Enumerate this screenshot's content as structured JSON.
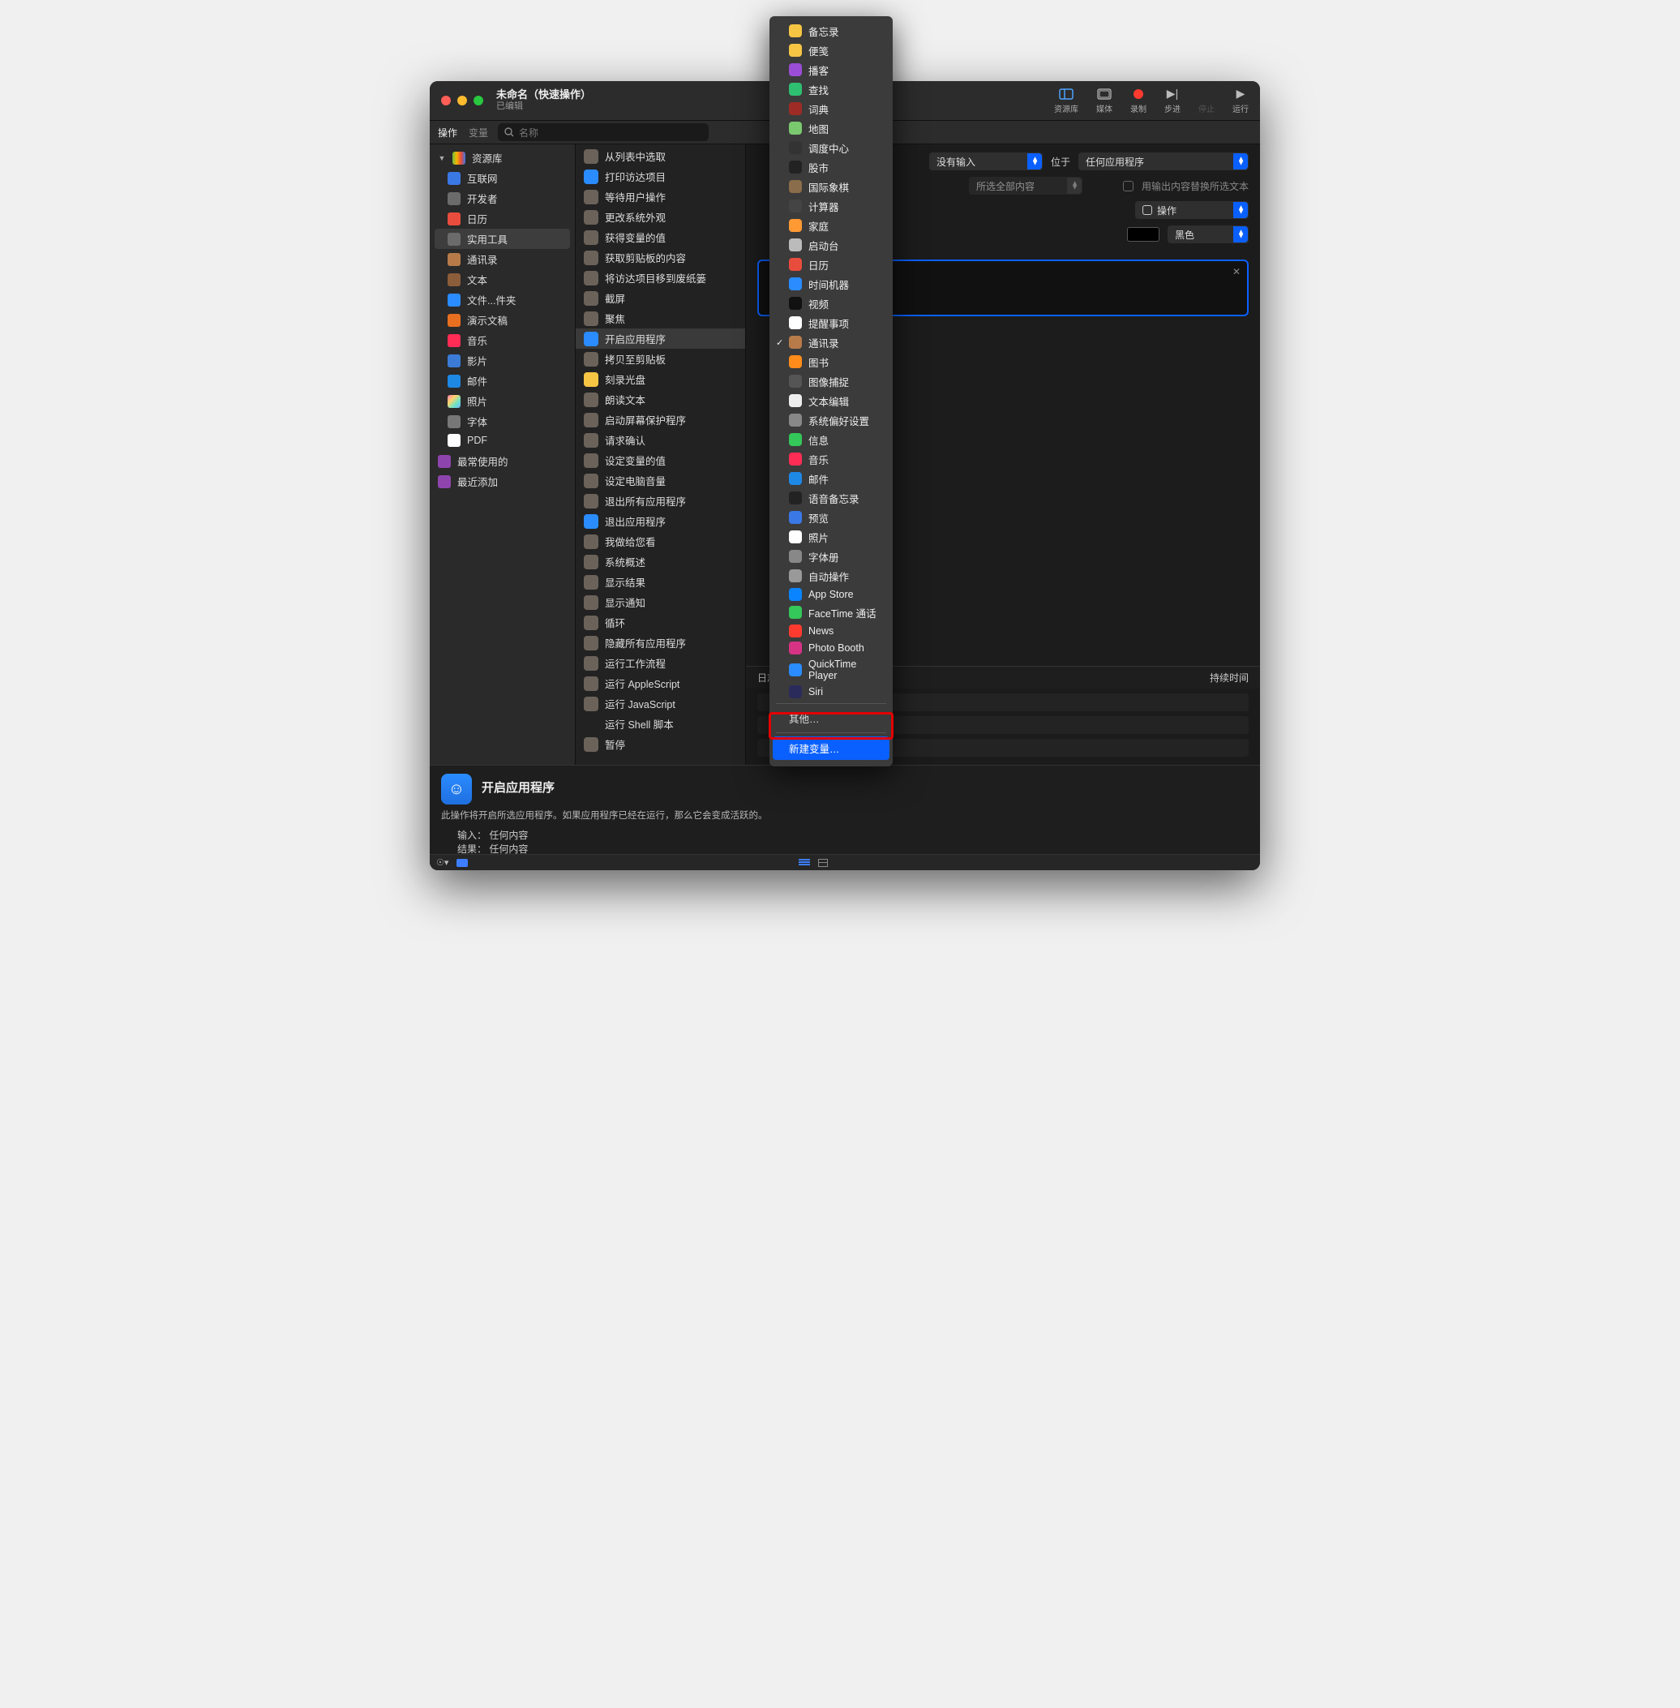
{
  "window": {
    "title": "未命名（快速操作）",
    "subtitle": "已编辑"
  },
  "toolbar": {
    "library": "资源库",
    "media": "媒体",
    "record": "录制",
    "step": "步进",
    "stop": "停止",
    "run": "运行"
  },
  "secondbar": {
    "tab_actions": "操作",
    "tab_vars": "变量",
    "search_placeholder": "名称"
  },
  "sidebar": {
    "root": "资源库",
    "items": [
      {
        "label": "互联网",
        "color": "#3a78e6"
      },
      {
        "label": "开发者",
        "color": "#6b6b6b"
      },
      {
        "label": "日历",
        "color": "#e84c3d"
      },
      {
        "label": "实用工具",
        "color": "#6b6b6b",
        "selected": true
      },
      {
        "label": "通讯录",
        "color": "#b77b4a"
      },
      {
        "label": "文本",
        "color": "#8b5d3a"
      },
      {
        "label": "文件...件夹",
        "color": "#2a8cff"
      },
      {
        "label": "演示文稿",
        "color": "#e86f1f"
      },
      {
        "label": "音乐",
        "color": "#ff2d55"
      },
      {
        "label": "影片",
        "color": "#3b7bd6"
      },
      {
        "label": "邮件",
        "color": "#1e88e5"
      },
      {
        "label": "照片",
        "color": "linear"
      },
      {
        "label": "字体",
        "color": "#777"
      },
      {
        "label": "PDF",
        "color": "#fff"
      }
    ],
    "footer": [
      {
        "label": "最常使用的"
      },
      {
        "label": "最近添加"
      }
    ]
  },
  "actions": [
    "从列表中选取",
    "打印访达项目",
    "等待用户操作",
    "更改系统外观",
    "获得变量的值",
    "获取剪贴板的内容",
    "将访达项目移到废纸篓",
    "截屏",
    "聚焦",
    "开启应用程序",
    "拷贝至剪贴板",
    "刻录光盘",
    "朗读文本",
    "启动屏幕保护程序",
    "请求确认",
    "设定变量的值",
    "设定电脑音量",
    "退出所有应用程序",
    "退出应用程序",
    "我做给您看",
    "系统概述",
    "显示结果",
    "显示通知",
    "循环",
    "隐藏所有应用程序",
    "运行工作流程",
    "运行 AppleScript",
    "运行 JavaScript",
    "运行 Shell 脚本",
    "暂停"
  ],
  "actions_selected_index": 9,
  "config": {
    "no_input": "没有输入",
    "at": "位于",
    "any_app": "任何应用程序",
    "all_selected": "所选全部内容",
    "replace_chk_label": "用输出内容替换所选文本",
    "action_label": "操作",
    "black": "黑色"
  },
  "log": {
    "title": "日志",
    "duration": "持续时间"
  },
  "desc": {
    "title": "开启应用程序",
    "body": "此操作将开启所选应用程序。如果应用程序已经在运行，那么它会变成活跃的。",
    "input_k": "输入：",
    "input_v": "任何内容",
    "result_k": "结果：",
    "result_v": "任何内容"
  },
  "dropdown": {
    "apps": [
      {
        "label": "备忘录",
        "c": "#f7c544"
      },
      {
        "label": "便笺",
        "c": "#f7c544"
      },
      {
        "label": "播客",
        "c": "#9b4dd6"
      },
      {
        "label": "查找",
        "c": "#2fbf71"
      },
      {
        "label": "词典",
        "c": "#9e2b25"
      },
      {
        "label": "地图",
        "c": "#7bc96f"
      },
      {
        "label": "调度中心",
        "c": "#333"
      },
      {
        "label": "股市",
        "c": "#222"
      },
      {
        "label": "国际象棋",
        "c": "#8a6d4a"
      },
      {
        "label": "计算器",
        "c": "#444"
      },
      {
        "label": "家庭",
        "c": "#ff9933"
      },
      {
        "label": "启动台",
        "c": "#bbb"
      },
      {
        "label": "日历",
        "c": "#e84c3d"
      },
      {
        "label": "时间机器",
        "c": "#2a8cff"
      },
      {
        "label": "视频",
        "c": "#111"
      },
      {
        "label": "提醒事项",
        "c": "#fff"
      },
      {
        "label": "通讯录",
        "c": "#b77b4a",
        "checked": true
      },
      {
        "label": "图书",
        "c": "#ff8c1a"
      },
      {
        "label": "图像捕捉",
        "c": "#555"
      },
      {
        "label": "文本编辑",
        "c": "#eee"
      },
      {
        "label": "系统偏好设置",
        "c": "#888"
      },
      {
        "label": "信息",
        "c": "#34c759"
      },
      {
        "label": "音乐",
        "c": "#ff2d55"
      },
      {
        "label": "邮件",
        "c": "#1e88e5"
      },
      {
        "label": "语音备忘录",
        "c": "#222"
      },
      {
        "label": "预览",
        "c": "#3a78e6"
      },
      {
        "label": "照片",
        "c": "#fff"
      },
      {
        "label": "字体册",
        "c": "#888"
      },
      {
        "label": "自动操作",
        "c": "#999"
      },
      {
        "label": "App Store",
        "c": "#0a84ff"
      },
      {
        "label": "FaceTime 通话",
        "c": "#34c759"
      },
      {
        "label": "News",
        "c": "#ff3b30"
      },
      {
        "label": "Photo Booth",
        "c": "#d63384"
      },
      {
        "label": "QuickTime Player",
        "c": "#2a8cff"
      },
      {
        "label": "Siri",
        "c": "#2b2b5b"
      }
    ],
    "other": "其他…",
    "new_var": "新建变量…"
  }
}
